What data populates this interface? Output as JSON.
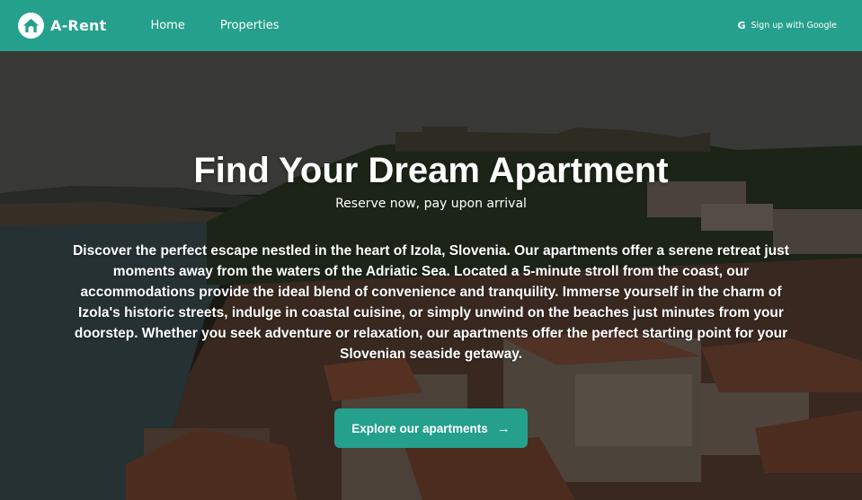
{
  "nav": {
    "brand": "A-Rent",
    "links": [
      {
        "label": "Home"
      },
      {
        "label": "Properties"
      }
    ],
    "signup_label": "Sign up with Google",
    "google_glyph": "G"
  },
  "hero": {
    "title": "Find Your Dream Apartment",
    "subtitle": "Reserve now, pay upon arrival",
    "description": "Discover the perfect escape nestled in the heart of Izola, Slovenia. Our apartments offer a serene retreat just moments away from the waters of the Adriatic Sea. Located a 5-minute stroll from the coast, our accommodations provide the ideal blend of convenience and tranquility. Immerse yourself in the charm of Izola's historic streets, indulge in coastal cuisine, or simply unwind on the beaches just minutes from your doorstep. Whether you seek adventure or relaxation, our apartments offer the perfect starting point for your Slovenian seaside getaway.",
    "cta_label": "Explore our apartments",
    "cta_icon": "arrow-right-icon"
  },
  "colors": {
    "brand": "#24a08c",
    "text": "#ffffff"
  }
}
